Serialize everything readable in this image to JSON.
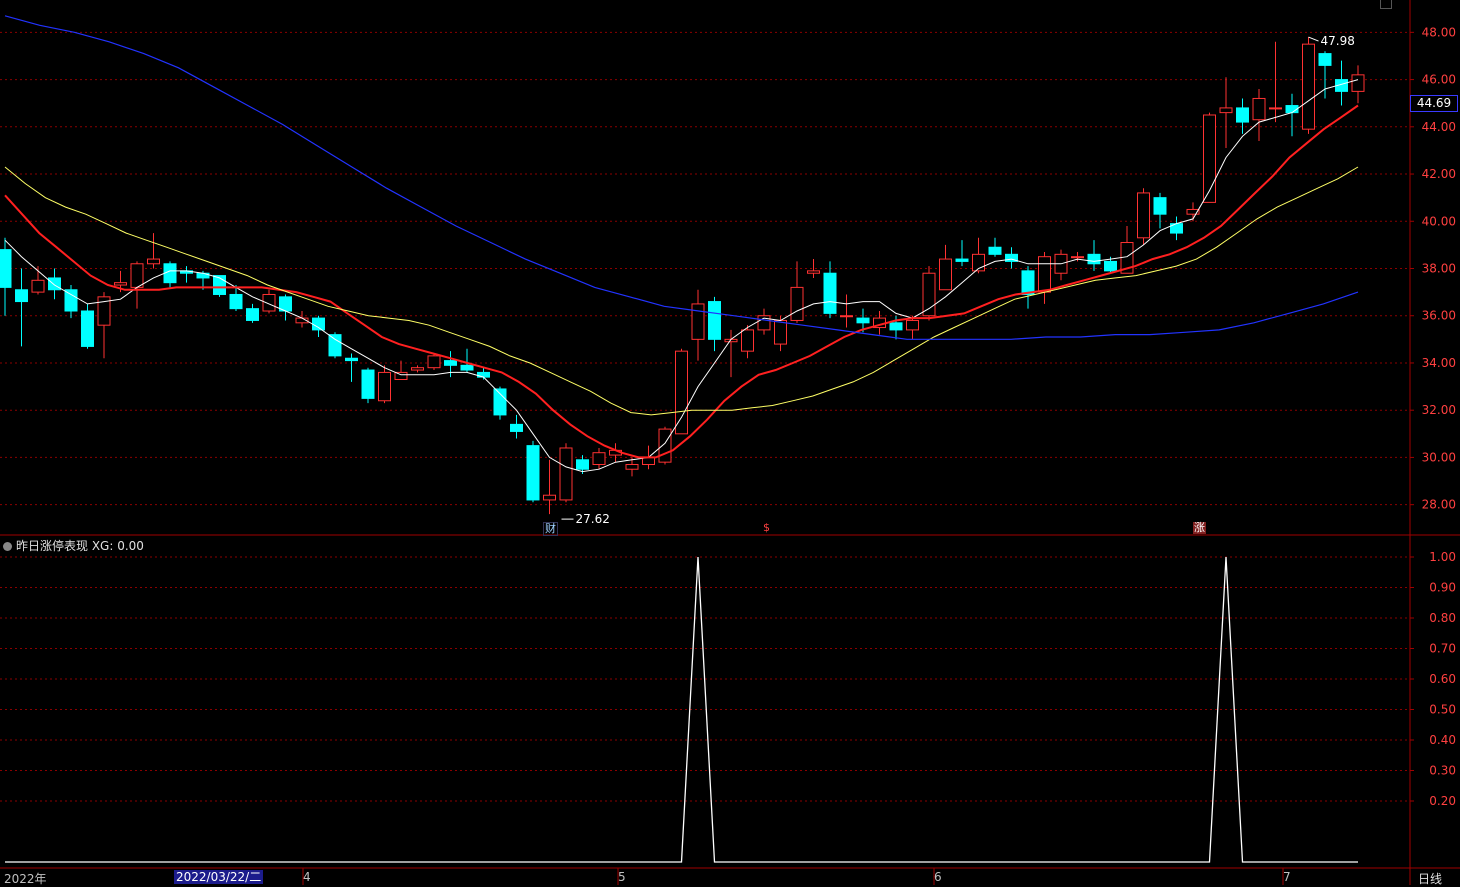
{
  "main_panel": {
    "price_tag": "44.69",
    "annotations": {
      "high_label": "47.98",
      "low_label": "27.62"
    },
    "event_marks": [
      "财",
      "$",
      "涨"
    ]
  },
  "indicator_panel": {
    "header": "昨日涨停表现  XG: 0.00"
  },
  "footer": {
    "date_cursor": "2022/03/22/二",
    "year_label": "2022年",
    "month_labels": [
      "4",
      "5",
      "6",
      "7"
    ],
    "period": "日线"
  },
  "colors": {
    "up": "#ff3232",
    "down": "#00ffff",
    "ma5": "#ffffff",
    "ma10": "#ff2020",
    "ma20": "#ffff66",
    "ma60": "#2233ff",
    "grid": "#8b0000",
    "axis": "#a00000"
  },
  "chart_data": [
    {
      "type": "candlestick",
      "y_axis": {
        "ticks": [
          28.0,
          30.0,
          32.0,
          34.0,
          36.0,
          38.0,
          40.0,
          42.0,
          44.0,
          46.0,
          48.0
        ],
        "range": [
          26.8,
          49.2
        ]
      },
      "candles": [
        [
          38.8,
          37.2,
          39.3,
          36.0
        ],
        [
          37.1,
          36.6,
          38.0,
          34.7
        ],
        [
          37.0,
          37.5,
          38.1,
          36.9
        ],
        [
          37.6,
          37.1,
          38.0,
          36.7
        ],
        [
          37.1,
          36.2,
          37.3,
          35.9
        ],
        [
          36.2,
          34.7,
          36.5,
          34.6
        ],
        [
          35.6,
          36.8,
          37.0,
          34.2
        ],
        [
          37.3,
          37.4,
          37.9,
          37.0
        ],
        [
          37.2,
          38.2,
          38.3,
          36.3
        ],
        [
          38.2,
          38.4,
          39.5,
          38.0
        ],
        [
          38.2,
          37.4,
          38.3,
          37.2
        ],
        [
          37.9,
          37.8,
          38.1,
          37.4
        ],
        [
          37.8,
          37.6,
          37.9,
          37.1
        ],
        [
          37.7,
          36.9,
          37.7,
          36.8
        ],
        [
          36.9,
          36.3,
          37.3,
          36.2
        ],
        [
          36.3,
          35.8,
          36.5,
          35.7
        ],
        [
          36.2,
          36.9,
          37.1,
          36.1
        ],
        [
          36.8,
          36.2,
          36.9,
          35.8
        ],
        [
          35.7,
          35.9,
          36.2,
          35.5
        ],
        [
          35.9,
          35.4,
          36.0,
          35.1
        ],
        [
          35.2,
          34.3,
          35.3,
          34.2
        ],
        [
          34.2,
          34.1,
          34.4,
          33.2
        ],
        [
          33.7,
          32.5,
          33.8,
          32.3
        ],
        [
          32.4,
          33.6,
          33.9,
          32.3
        ],
        [
          33.3,
          33.6,
          34.1,
          33.3
        ],
        [
          33.7,
          33.8,
          33.9,
          33.6
        ],
        [
          33.8,
          34.3,
          34.4,
          33.7
        ],
        [
          34.1,
          33.9,
          34.5,
          33.4
        ],
        [
          33.9,
          33.7,
          34.6,
          33.6
        ],
        [
          33.6,
          33.4,
          33.8,
          33.3
        ],
        [
          32.9,
          31.8,
          33.0,
          31.6
        ],
        [
          31.4,
          31.1,
          31.8,
          30.8
        ],
        [
          30.5,
          28.2,
          30.7,
          28.1
        ],
        [
          28.2,
          28.4,
          29.9,
          27.6
        ],
        [
          28.2,
          30.4,
          30.6,
          28.1
        ],
        [
          29.9,
          29.5,
          30.1,
          29.3
        ],
        [
          29.7,
          30.2,
          30.4,
          29.5
        ],
        [
          30.1,
          30.3,
          30.6,
          29.8
        ],
        [
          29.5,
          29.7,
          30.0,
          29.2
        ],
        [
          29.7,
          30.0,
          30.5,
          29.5
        ],
        [
          29.8,
          31.2,
          31.3,
          29.7
        ],
        [
          31.0,
          34.5,
          34.6,
          31.0
        ],
        [
          35.0,
          36.5,
          37.1,
          34.1
        ],
        [
          36.6,
          35.0,
          36.8,
          34.5
        ],
        [
          34.9,
          35.0,
          35.4,
          33.4
        ],
        [
          34.5,
          35.4,
          35.6,
          34.2
        ],
        [
          35.4,
          36.0,
          36.3,
          35.2
        ],
        [
          34.8,
          35.8,
          36.0,
          34.5
        ],
        [
          35.8,
          37.2,
          38.3,
          35.7
        ],
        [
          37.8,
          37.9,
          38.4,
          37.6
        ],
        [
          37.8,
          36.1,
          38.3,
          35.9
        ],
        [
          36.0,
          36.0,
          36.9,
          35.5
        ],
        [
          35.9,
          35.7,
          36.3,
          35.3
        ],
        [
          35.5,
          35.9,
          36.2,
          35.2
        ],
        [
          35.7,
          35.4,
          36.0,
          35.0
        ],
        [
          35.4,
          35.8,
          36.0,
          35.0
        ],
        [
          36.0,
          37.8,
          38.1,
          35.8
        ],
        [
          37.1,
          38.4,
          39.0,
          37.1
        ],
        [
          38.4,
          38.3,
          39.2,
          38.1
        ],
        [
          37.9,
          38.6,
          39.3,
          37.8
        ],
        [
          38.9,
          38.6,
          39.3,
          38.5
        ],
        [
          38.6,
          38.3,
          38.9,
          38.0
        ],
        [
          37.9,
          36.9,
          38.1,
          36.3
        ],
        [
          37.0,
          38.5,
          38.7,
          36.5
        ],
        [
          37.8,
          38.6,
          38.8,
          37.5
        ],
        [
          38.5,
          38.5,
          38.7,
          38.3
        ],
        [
          38.6,
          38.2,
          39.2,
          37.9
        ],
        [
          38.3,
          37.9,
          38.5,
          37.8
        ],
        [
          37.8,
          39.1,
          39.8,
          37.8
        ],
        [
          39.3,
          41.2,
          41.4,
          39.0
        ],
        [
          41.0,
          40.3,
          41.2,
          39.7
        ],
        [
          39.9,
          39.5,
          40.2,
          39.2
        ],
        [
          40.3,
          40.5,
          40.8,
          40.0
        ],
        [
          40.8,
          44.5,
          44.6,
          40.8
        ],
        [
          44.6,
          44.8,
          46.1,
          43.1
        ],
        [
          44.8,
          44.2,
          45.2,
          43.7
        ],
        [
          44.3,
          45.2,
          45.6,
          43.4
        ],
        [
          44.8,
          44.8,
          47.6,
          44.2
        ],
        [
          44.9,
          44.6,
          45.4,
          43.6
        ],
        [
          43.9,
          47.5,
          47.8,
          43.7
        ],
        [
          47.1,
          46.6,
          47.2,
          45.2
        ],
        [
          46.0,
          45.5,
          46.8,
          44.9
        ],
        [
          45.5,
          46.2,
          46.6,
          45.0
        ]
      ],
      "ma_lines": [
        {
          "name": "MA5",
          "values": [
            39.2,
            38.5,
            37.9,
            37.3,
            36.9,
            36.5,
            36.6,
            36.7,
            37.2,
            37.6,
            37.9,
            37.9,
            37.8,
            37.6,
            37.2,
            36.8,
            36.5,
            36.2,
            35.9,
            35.5,
            35.0,
            34.6,
            34.2,
            33.8,
            33.5,
            33.5,
            33.5,
            33.6,
            33.6,
            33.4,
            32.7,
            32.0,
            31.0,
            30.0,
            29.6,
            29.4,
            29.5,
            29.8,
            29.9,
            30.0,
            30.6,
            31.7,
            33.0,
            34.0,
            35.0,
            35.5,
            35.9,
            35.8,
            36.2,
            36.5,
            36.6,
            36.5,
            36.6,
            36.6,
            36.1,
            35.9,
            36.3,
            36.8,
            37.4,
            38.0,
            38.3,
            38.4,
            38.2,
            38.2,
            38.2,
            38.4,
            38.3,
            38.4,
            38.5,
            39.0,
            39.6,
            39.9,
            40.1,
            41.3,
            42.7,
            43.6,
            44.2,
            44.4,
            44.6,
            45.1,
            45.6,
            45.8,
            46.0
          ]
        },
        {
          "name": "MA10",
          "values": [
            41.1,
            40.3,
            39.5,
            38.9,
            38.3,
            37.7,
            37.3,
            37.1,
            37.1,
            37.1,
            37.2,
            37.2,
            37.2,
            37.2,
            37.2,
            37.2,
            37.1,
            37.0,
            36.8,
            36.6,
            36.1,
            35.6,
            35.1,
            34.8,
            34.6,
            34.4,
            34.2,
            34.0,
            33.8,
            33.6,
            33.2,
            32.7,
            32.0,
            31.4,
            30.9,
            30.5,
            30.2,
            30.0,
            30.0,
            30.3,
            30.9,
            31.6,
            32.4,
            33.0,
            33.5,
            33.7,
            34.0,
            34.3,
            34.7,
            35.1,
            35.4,
            35.6,
            35.8,
            35.9,
            35.9,
            36.0,
            36.1,
            36.4,
            36.7,
            36.9,
            37.0,
            37.1,
            37.3,
            37.5,
            37.7,
            37.9,
            38.1,
            38.4,
            38.6,
            38.9,
            39.3,
            39.8,
            40.5,
            41.2,
            41.9,
            42.7,
            43.3,
            43.9,
            44.4,
            44.9
          ]
        },
        {
          "name": "MA20",
          "values": [
            42.3,
            41.6,
            41.0,
            40.6,
            40.3,
            39.9,
            39.5,
            39.2,
            38.9,
            38.6,
            38.3,
            38.0,
            37.7,
            37.3,
            37.0,
            36.7,
            36.4,
            36.2,
            36.0,
            35.9,
            35.8,
            35.6,
            35.3,
            35.0,
            34.7,
            34.3,
            34.0,
            33.6,
            33.2,
            32.8,
            32.3,
            31.9,
            31.8,
            31.9,
            32.0,
            32.0,
            32.0,
            32.1,
            32.2,
            32.4,
            32.6,
            32.9,
            33.2,
            33.6,
            34.1,
            34.6,
            35.1,
            35.5,
            35.9,
            36.3,
            36.7,
            36.9,
            37.1,
            37.3,
            37.5,
            37.6,
            37.7,
            37.9,
            38.1,
            38.4,
            38.9,
            39.5,
            40.1,
            40.6,
            41.0,
            41.4,
            41.8,
            42.3
          ]
        },
        {
          "name": "MA60",
          "values": [
            48.7,
            48.3,
            48.0,
            47.6,
            47.1,
            46.5,
            45.7,
            44.9,
            44.1,
            43.2,
            42.3,
            41.4,
            40.6,
            39.8,
            39.1,
            38.4,
            37.8,
            37.2,
            36.8,
            36.4,
            36.2,
            36.0,
            35.8,
            35.6,
            35.4,
            35.2,
            35.0,
            35.0,
            35.0,
            35.0,
            35.1,
            35.1,
            35.2,
            35.2,
            35.3,
            35.4,
            35.7,
            36.1,
            36.5,
            37.0
          ]
        }
      ]
    },
    {
      "type": "line",
      "series": [
        {
          "name": "XG",
          "points": [
            [
              0,
              0
            ],
            [
              41,
              0
            ],
            [
              42,
              1
            ],
            [
              43,
              0
            ],
            [
              73,
              0
            ],
            [
              74,
              1
            ],
            [
              75,
              0
            ],
            [
              82,
              0
            ]
          ]
        }
      ],
      "y_axis": {
        "ticks": [
          0.2,
          0.3,
          0.4,
          0.5,
          0.6,
          0.7,
          0.8,
          0.9,
          1.0
        ],
        "range": [
          0,
          1
        ]
      }
    }
  ]
}
